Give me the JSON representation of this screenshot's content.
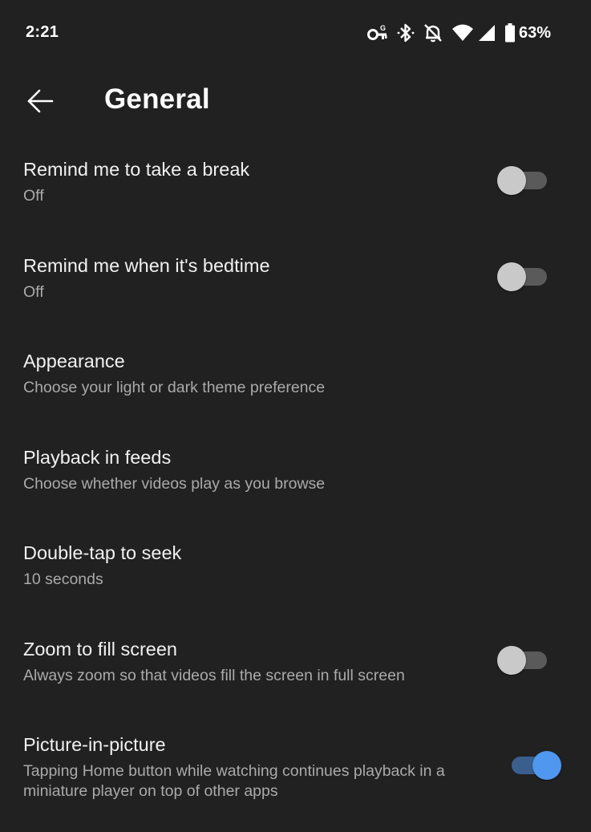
{
  "status_bar": {
    "time": "2:21",
    "battery": "63%",
    "icons": [
      "vpn-key-icon",
      "bluetooth-icon",
      "notifications-off-icon",
      "wifi-icon",
      "cell-signal-icon",
      "battery-icon"
    ]
  },
  "header": {
    "back_icon": "arrow-back-icon",
    "title": "General"
  },
  "settings": [
    {
      "title": "Remind me to take a break",
      "subtitle": "Off",
      "toggle": true,
      "on": false
    },
    {
      "title": "Remind me when it's bedtime",
      "subtitle": "Off",
      "toggle": true,
      "on": false
    },
    {
      "title": "Appearance",
      "subtitle": "Choose your light or dark theme preference",
      "toggle": false
    },
    {
      "title": "Playback in feeds",
      "subtitle": "Choose whether videos play as you browse",
      "toggle": false
    },
    {
      "title": "Double-tap to seek",
      "subtitle": "10 seconds",
      "toggle": false
    },
    {
      "title": "Zoom to fill screen",
      "subtitle": "Always zoom so that videos fill the screen in full screen",
      "toggle": true,
      "on": false
    },
    {
      "title": "Picture-in-picture",
      "subtitle": "Tapping Home button while watching continues playback in a miniature player on top of other apps",
      "toggle": true,
      "on": true
    }
  ],
  "colors": {
    "background": "#212121",
    "toggle_on": "#4f97ef",
    "toggle_off": "#c9c9c9"
  }
}
